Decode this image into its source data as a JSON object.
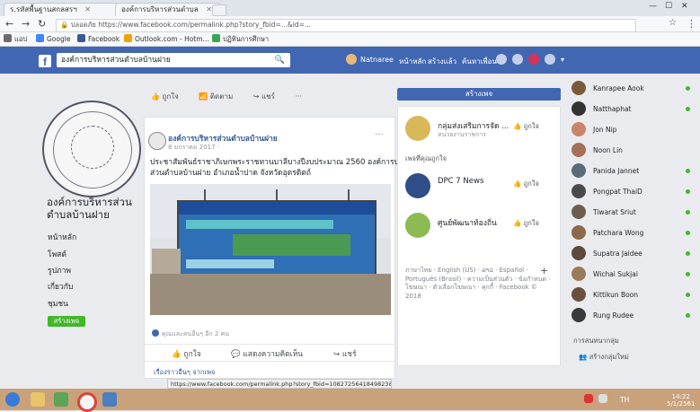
{
  "browser": {
    "tabs": [
      {
        "label": "ร.รหัสพื้นฐานสกลสรฯ"
      },
      {
        "label": "องค์การบริหารส่วนตำบล"
      }
    ],
    "url": "ปลอดภัย  https://www.facebook.com/permalink.php?story_fbid=...&id=...",
    "bookmarks": [
      {
        "label": "แอป",
        "icon": "apps-icon",
        "color": "#6b6b6b"
      },
      {
        "label": "Google",
        "icon": "google-icon",
        "color": "#4285f4"
      },
      {
        "label": "Facebook",
        "icon": "facebook-icon",
        "color": "#3b5998"
      },
      {
        "label": "Outlook.com - Hotm...",
        "icon": "outlook-icon",
        "color": "#f0a30a"
      },
      {
        "label": "ปฏิทินการศึกษา",
        "icon": "calendar-icon",
        "color": "#34a853"
      }
    ]
  },
  "fb": {
    "search_value": "องค์การบริหารส่วนตำบลบ้านฝาย",
    "user": "Natnaree",
    "nav": [
      "หน้าหลัก",
      "สร้างแล้ว",
      "ค้นหาเพื่อน"
    ]
  },
  "page": {
    "name": "องค์การบริหารส่วนตำบลบ้านฝาย",
    "nav": [
      "หน้าหลัก",
      "โพสต์",
      "รูปภาพ",
      "เกี่ยวกับ",
      "ชุมชน"
    ],
    "create_page": "สร้างเพจ"
  },
  "feed": {
    "toolbar": [
      "ถูกใจ",
      "ติดตาม",
      "แชร์"
    ],
    "post": {
      "author": "องค์การบริหารส่วนตำบลบ้านฝาย",
      "meta": "8 มกราคม 2017 ·",
      "text_line1": "ประชาสัมพันธ์ราชาภิเษกพระราชทานบาลีบางปีงบประมาณ 2560 องค์การบริหาร",
      "text_line2": "ส่วนตำบลบ้านฝาย อำเภอน้ำปาด จังหวัดอุตรดิตถ์",
      "reactions": "คุณและคนอื่นๆ อีก 2 คน",
      "actions": [
        "ถูกใจ",
        "แสดงความคิดเห็น",
        "แชร์"
      ],
      "see_more": "เรื่องราวอื่นๆ จากเพจ"
    }
  },
  "right": {
    "create_button": "สร้างเพจ",
    "top_item": {
      "name": "กลุ่มส่งเสริมการจัด ...",
      "sub": "หน่วยงานราชการ",
      "like": "ถูกใจ"
    },
    "heading": "เพจที่คุณถูกใจ",
    "items": [
      {
        "name": "DPC 7 News",
        "like": "ถูกใจ"
      },
      {
        "name": "ศูนย์พัฒนาท้องถิ่น",
        "like": "ถูกใจ"
      }
    ],
    "footer": "ภาษาไทย · English (US) · ລາວ · Español · Português (Brasil) · ความเป็นส่วนตัว · ข้อกำหนด · โฆษณา · ตัวเลือกโฆษณา · คุกกี้ · Facebook © 2018"
  },
  "chat": {
    "contacts": [
      {
        "name": "Kanrapee Aook",
        "color": "#7a5a3c"
      },
      {
        "name": "Natthaphat",
        "color": "#333333"
      },
      {
        "name": "Jon Nip",
        "color": "#c9846a"
      },
      {
        "name": "Noon Lin",
        "color": "#a5705a"
      },
      {
        "name": "Panida Jannet",
        "color": "#5a6b7b"
      },
      {
        "name": "Pongpat ThaiD",
        "color": "#4a4a4a"
      },
      {
        "name": "Tiwarat Sriut",
        "color": "#6d5d4d"
      },
      {
        "name": "Patchara Wong",
        "color": "#8a6a4a"
      },
      {
        "name": "Supatra Jaidee",
        "color": "#5d4a3a"
      },
      {
        "name": "Wichai Sukjai",
        "color": "#9a7a5a"
      },
      {
        "name": "Kittikun Boon",
        "color": "#6a5040"
      },
      {
        "name": "Rung Rudee",
        "color": "#3a3a3a"
      }
    ],
    "groups_heading": "การสนทนากลุ่ม",
    "create_group": "สร้างกลุ่มใหม่"
  },
  "statusbar": {
    "url": "https://www.facebook.com/permalink.php?story_fbid=1082725641849823&id=..."
  },
  "taskbar": {
    "time": "14:22",
    "date": "5/1/2561",
    "tray": "TH"
  }
}
